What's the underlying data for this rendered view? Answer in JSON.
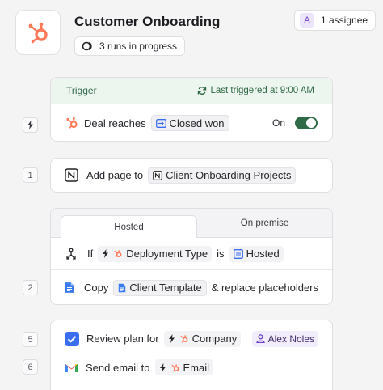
{
  "header": {
    "title": "Customer Onboarding",
    "runs": "3 runs in progress",
    "assignee_initial": "A",
    "assignee": "1 assignee",
    "brand_color": "#ff7a59"
  },
  "trigger": {
    "label": "Trigger",
    "last_triggered": "Last triggered at 9:00 AM",
    "text": "Deal reaches",
    "stage": "Closed won",
    "toggle_label": "On",
    "toggle_on": true,
    "step_icon": "lightning-icon"
  },
  "steps": [
    {
      "number": "1",
      "text": "Add page to",
      "target": "Client Onboarding Projects",
      "icon": "notion-icon"
    },
    {
      "number": "2",
      "tabs": [
        "Hosted",
        "On premise"
      ],
      "active_tab": "Hosted",
      "condition": {
        "if": "If",
        "field": "Deployment Type",
        "op": "is",
        "value": "Hosted"
      },
      "action": {
        "text": "Copy",
        "doc": "Client Template",
        "suffix": "& replace placeholders",
        "icon": "google-docs-icon"
      }
    },
    {
      "number": "5",
      "text": "Review plan for",
      "field": "Company",
      "assignee": "Alex Noles",
      "icon": "checkbox-icon"
    },
    {
      "number": "6",
      "text": "Send email to",
      "field": "Email",
      "icon": "gmail-icon"
    }
  ],
  "colors": {
    "accent_green": "#2f6b46",
    "trigger_bg": "#edf5ef",
    "task_blue": "#3b6df0"
  }
}
